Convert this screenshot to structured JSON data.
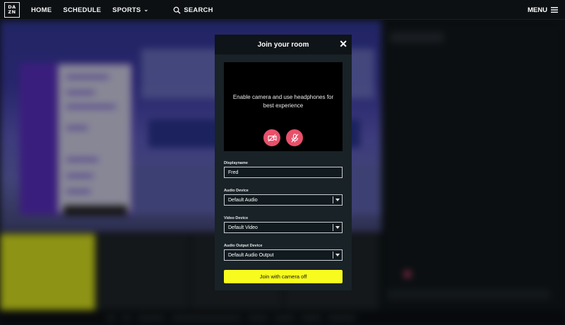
{
  "nav": {
    "logo_top": "DA",
    "logo_bottom": "ZN",
    "items": [
      {
        "label": "HOME"
      },
      {
        "label": "SCHEDULE"
      },
      {
        "label": "SPORTS"
      }
    ],
    "search_label": "SEARCH",
    "menu_label": "MENU"
  },
  "modal": {
    "title": "Join your room",
    "preview_text": "Enable camera and use headphones for best experience",
    "display_name": {
      "label": "Displayname",
      "value": "Fred"
    },
    "audio_device": {
      "label": "Audio Device",
      "selected": "Default Audio"
    },
    "video_device": {
      "label": "Video Device",
      "selected": "Default Video"
    },
    "audio_output": {
      "label": "Audio Output Device",
      "selected": "Default Audio Output"
    },
    "join_button": "Join with camera off"
  },
  "colors": {
    "accent_yellow": "#f7fc1e",
    "mute_red": "#e8506b",
    "modal_bg": "#192227"
  },
  "icons": {
    "camera_off": "camera-off-icon",
    "mic_off": "mic-off-icon",
    "search": "search-icon",
    "close": "close-icon",
    "hamburger": "hamburger-icon"
  }
}
